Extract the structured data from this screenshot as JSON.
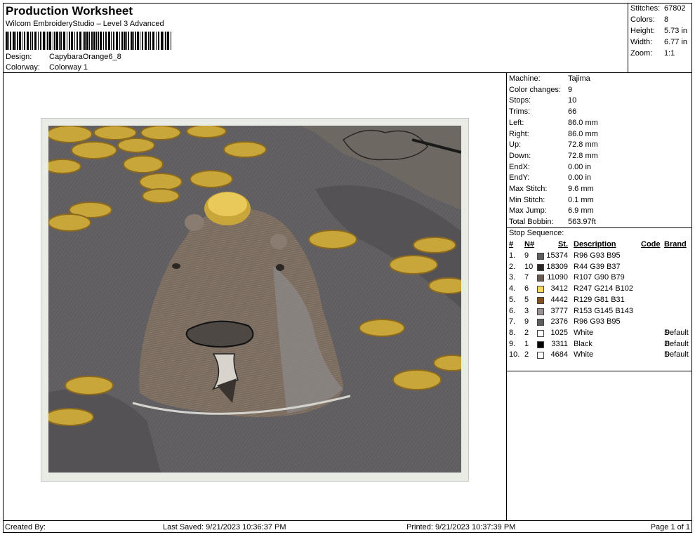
{
  "header": {
    "title": "Production Worksheet",
    "subtitle": "Wilcom EmbroideryStudio – Level 3 Advanced",
    "design_label": "Design:",
    "design_value": "CapybaraOrange6_8",
    "colorway_label": "Colorway:",
    "colorway_value": "Colorway 1"
  },
  "summary": [
    {
      "label": "Stitches:",
      "value": "67802"
    },
    {
      "label": "Colors:",
      "value": "8"
    },
    {
      "label": "Height:",
      "value": "5.73 in"
    },
    {
      "label": "Width:",
      "value": "6.77 in"
    },
    {
      "label": "Zoom:",
      "value": "1:1"
    }
  ],
  "machine_info": [
    {
      "label": "Machine:",
      "value": "Tajima"
    },
    {
      "label": "Color changes:",
      "value": "9"
    },
    {
      "label": "Stops:",
      "value": "10"
    },
    {
      "label": "Trims:",
      "value": "66"
    },
    {
      "label": "Left:",
      "value": "86.0 mm"
    },
    {
      "label": "Right:",
      "value": "86.0 mm"
    },
    {
      "label": "Up:",
      "value": "72.8 mm"
    },
    {
      "label": "Down:",
      "value": "72.8 mm"
    },
    {
      "label": "EndX:",
      "value": "0.00 in"
    },
    {
      "label": "EndY:",
      "value": "0.00 in"
    },
    {
      "label": "Max Stitch:",
      "value": "9.6 mm"
    },
    {
      "label": "Min Stitch:",
      "value": "0.1 mm"
    },
    {
      "label": "Max Jump:",
      "value": "6.9 mm"
    },
    {
      "label": "Total Bobbin:",
      "value": "563.97ft"
    }
  ],
  "stop_sequence": {
    "title": "Stop Sequence:",
    "headers": {
      "num": "#",
      "needle": "N#",
      "stitches": "St.",
      "description": "Description",
      "code": "Code",
      "brand": "Brand"
    },
    "rows": [
      {
        "num": "1.",
        "needle": "9",
        "color": "#605d5f",
        "stitches": "15374",
        "description": "R96 G93 B95",
        "code": "",
        "brand": ""
      },
      {
        "num": "2.",
        "needle": "10",
        "color": "#2c2725",
        "stitches": "18309",
        "description": "R44 G39 B37",
        "code": "",
        "brand": ""
      },
      {
        "num": "3.",
        "needle": "7",
        "color": "#6b5a4f",
        "stitches": "11090",
        "description": "R107 G90 B79",
        "code": "",
        "brand": ""
      },
      {
        "num": "4.",
        "needle": "6",
        "color": "#f7d666",
        "stitches": "3412",
        "description": "R247 G214 B102",
        "code": "",
        "brand": ""
      },
      {
        "num": "5.",
        "needle": "5",
        "color": "#81511f",
        "stitches": "4442",
        "description": "R129 G81 B31",
        "code": "",
        "brand": ""
      },
      {
        "num": "6.",
        "needle": "3",
        "color": "#99918f",
        "stitches": "3777",
        "description": "R153 G145 B143",
        "code": "",
        "brand": ""
      },
      {
        "num": "7.",
        "needle": "9",
        "color": "#605d5f",
        "stitches": "2376",
        "description": "R96 G93 B95",
        "code": "",
        "brand": ""
      },
      {
        "num": "8.",
        "needle": "2",
        "color": "#ffffff",
        "stitches": "1025",
        "description": "White",
        "code": "9",
        "brand": "Default"
      },
      {
        "num": "9.",
        "needle": "1",
        "color": "#000000",
        "stitches": "3311",
        "description": "Black",
        "code": "8",
        "brand": "Default"
      },
      {
        "num": "10.",
        "needle": "2",
        "color": "#ffffff",
        "stitches": "4684",
        "description": "White",
        "code": "9",
        "brand": "Default"
      }
    ]
  },
  "footer": {
    "created_by": "Created By:",
    "last_saved": "Last Saved: 9/21/2023 10:36:37 PM",
    "printed": "Printed: 9/21/2023 10:37:39 PM",
    "page": "Page 1 of 1"
  }
}
